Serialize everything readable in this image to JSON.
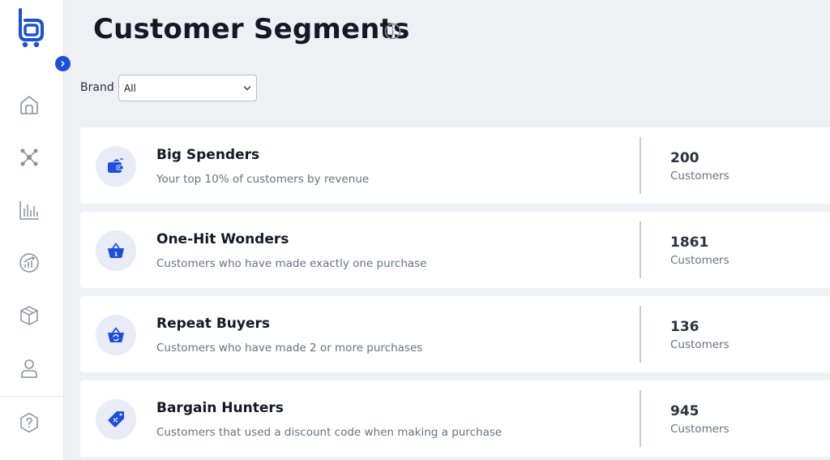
{
  "header": {
    "title": "Customer Segments"
  },
  "filters": {
    "brand_label": "Brand",
    "brand_value": "All"
  },
  "sidebar": {
    "items": [
      {
        "icon": "home-icon"
      },
      {
        "icon": "network-icon"
      },
      {
        "icon": "bar-chart-icon"
      },
      {
        "icon": "growth-chart-icon"
      },
      {
        "icon": "box-icon"
      },
      {
        "icon": "user-icon"
      },
      {
        "icon": "help-icon"
      }
    ]
  },
  "segments": [
    {
      "icon": "wallet-icon",
      "title": "Big Spenders",
      "description": "Your top 10% of customers by revenue",
      "count": "200",
      "unit": "Customers"
    },
    {
      "icon": "basket-one-icon",
      "title": "One-Hit Wonders",
      "description": "Customers who have made exactly one purchase",
      "count": "1861",
      "unit": "Customers"
    },
    {
      "icon": "basket-repeat-icon",
      "title": "Repeat Buyers",
      "description": "Customers who have made 2 or more purchases",
      "count": "136",
      "unit": "Customers"
    },
    {
      "icon": "discount-tag-icon",
      "title": "Bargain Hunters",
      "description": "Customers that used a discount code when making a purchase",
      "count": "945",
      "unit": "Customers"
    }
  ],
  "colors": {
    "accent": "#1d4fd8",
    "icon_bg": "#e9ecf6",
    "page_bg": "#eef0f4",
    "text": "#151826",
    "muted": "#6b7080"
  }
}
